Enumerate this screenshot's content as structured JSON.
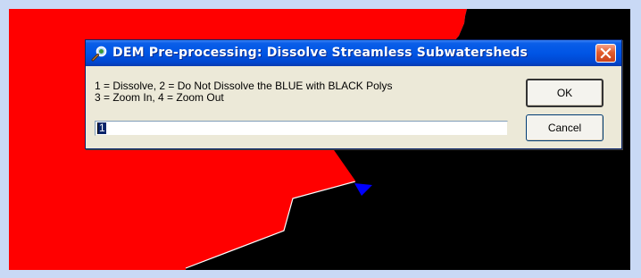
{
  "map": {
    "background_color": "#c9d9f5",
    "stream_poly_color": "#ff0000",
    "streamless_poly_color": "#000000",
    "highlight_poly_color": "#0000ff"
  },
  "dialog": {
    "title": "DEM Pre-processing: Dissolve Streamless Subwatersheds",
    "icon": "search-icon",
    "close_icon": "close-icon",
    "prompt_line1": "1 = Dissolve, 2 = Do Not Dissolve the BLUE with BLACK Polys",
    "prompt_line2": "3 = Zoom In, 4 = Zoom Out",
    "input_value": "1",
    "ok_label": "OK",
    "cancel_label": "Cancel",
    "title_bar_color": "#0055e5",
    "close_button_color": "#e25d2d"
  }
}
